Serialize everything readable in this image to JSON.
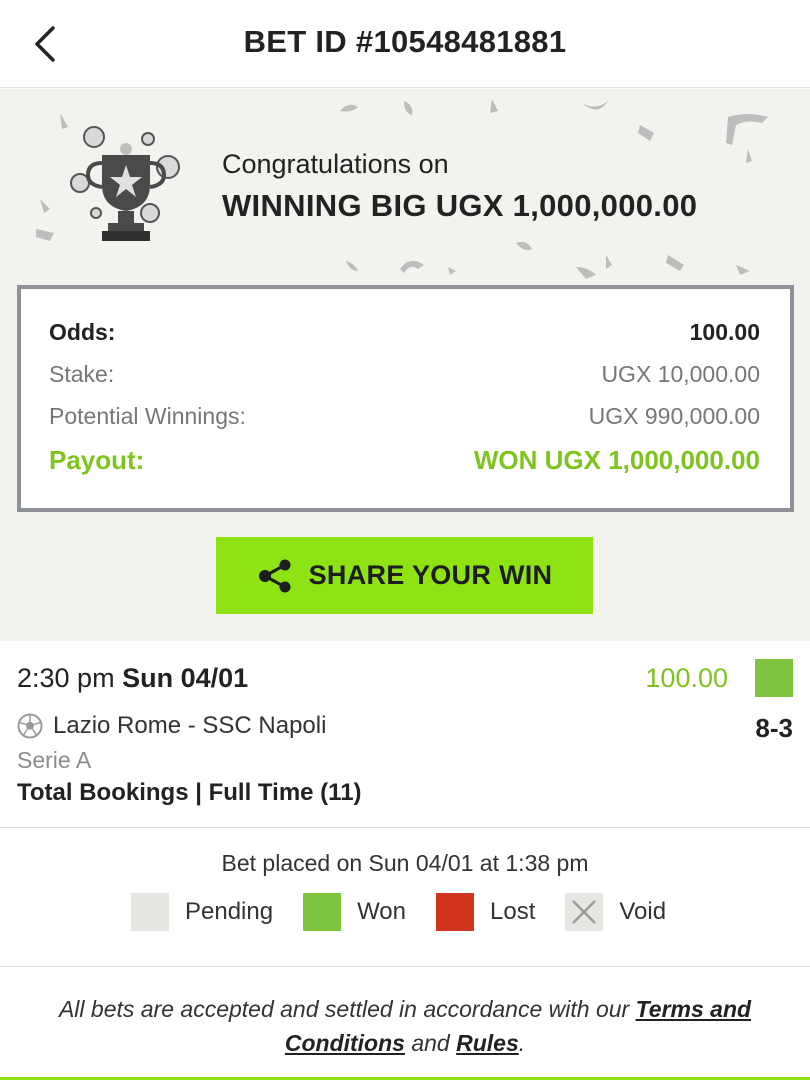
{
  "header": {
    "title": "BET ID #10548481881"
  },
  "hero": {
    "congrats_line": "Congratulations on",
    "win_line": "WINNING BIG UGX 1,000,000.00"
  },
  "summary": {
    "odds_label": "Odds:",
    "odds_value": "100.00",
    "stake_label": "Stake:",
    "stake_value": "UGX 10,000.00",
    "potential_label": "Potential Winnings:",
    "potential_value": "UGX 990,000.00",
    "payout_label": "Payout:",
    "payout_value": "WON UGX 1,000,000.00"
  },
  "share": {
    "label": "SHARE YOUR WIN"
  },
  "bet_item": {
    "time": "2:30 pm",
    "date": "Sun 04/01",
    "odds": "100.00",
    "status": "won",
    "match": "Lazio Rome - SSC Napoli",
    "score": "8-3",
    "league": "Serie A",
    "market": "Total Bookings | Full Time (11)"
  },
  "placed": {
    "text": "Bet placed on Sun 04/01 at 1:38 pm"
  },
  "legend": [
    {
      "label": "Pending",
      "color": "#e6e6e3"
    },
    {
      "label": "Won",
      "color": "#7dc340"
    },
    {
      "label": "Lost",
      "color": "#d0341c"
    },
    {
      "label": "Void",
      "color": "#e6e6e3"
    }
  ],
  "footer": {
    "text_before": "All bets are accepted and settled in accordance with our ",
    "terms_link": "Terms and Conditions",
    "text_middle": " and ",
    "rules_link": "Rules",
    "text_after": "."
  },
  "colors": {
    "accent_green": "#8fe314",
    "won_green": "#7fc31f",
    "lost_red": "#d0341c"
  },
  "icons": {
    "back": "chevron-left-icon",
    "share": "share-icon",
    "sport": "soccer-ball-icon",
    "trophy": "trophy-icon"
  }
}
